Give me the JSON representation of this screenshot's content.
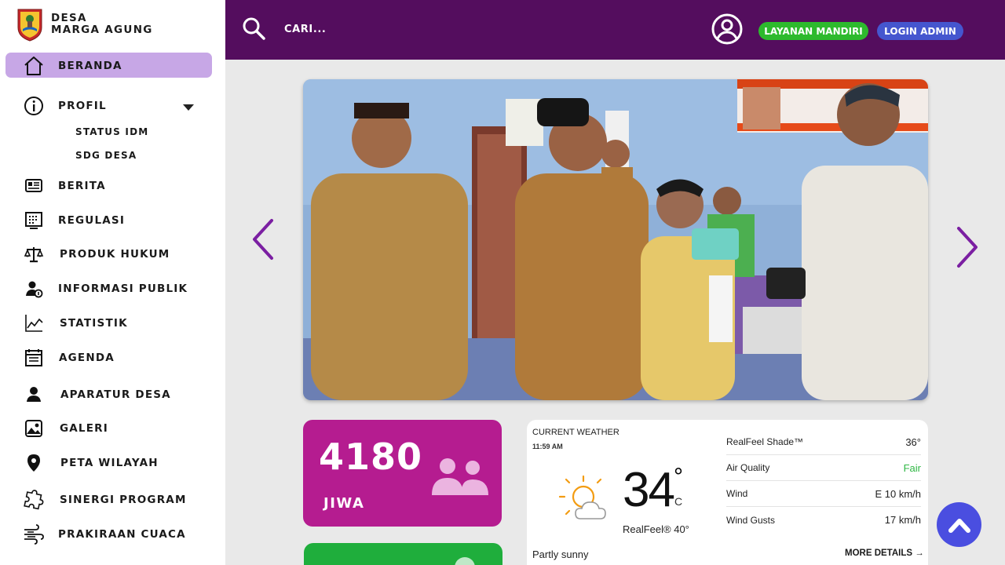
{
  "brand": {
    "line1": "DESA",
    "line2": "MARGA AGUNG"
  },
  "search": {
    "placeholder": "CARI..."
  },
  "header": {
    "layanan_label": "LAYANAN MANDIRI",
    "login_label": "LOGIN ADMIN"
  },
  "sidebar": {
    "active": "BERANDA",
    "items": [
      {
        "label": "BERANDA",
        "icon": "home-icon"
      },
      {
        "label": "PROFIL",
        "icon": "info-icon"
      },
      {
        "label": "BERITA",
        "icon": "newspaper-icon"
      },
      {
        "label": "REGULASI",
        "icon": "document-grid-icon"
      },
      {
        "label": "PRODUK HUKUM",
        "icon": "scales-icon"
      },
      {
        "label": "INFORMASI PUBLIK",
        "icon": "user-info-icon"
      },
      {
        "label": "STATISTIK",
        "icon": "chart-icon"
      },
      {
        "label": "AGENDA",
        "icon": "calendar-icon"
      },
      {
        "label": "APARATUR DESA",
        "icon": "person-icon"
      },
      {
        "label": "GALERI",
        "icon": "gallery-icon"
      },
      {
        "label": "PETA WILAYAH",
        "icon": "map-pin-icon"
      },
      {
        "label": "SINERGI PROGRAM",
        "icon": "puzzle-icon"
      },
      {
        "label": "PRAKIRAAN CUACA",
        "icon": "wind-icon"
      }
    ],
    "profil_sub": [
      "STATUS  IDM",
      "SDG DESA"
    ]
  },
  "stats": {
    "population": "4180",
    "unit": "JIWA"
  },
  "weather": {
    "title": "CURRENT WEATHER",
    "time": "11:59 AM",
    "temp": "34",
    "degree": "°",
    "unit": "C",
    "realfeel": "RealFeel® 40°",
    "condition": "Partly sunny",
    "more": "MORE DETAILS",
    "details": [
      {
        "label": "RealFeel Shade™",
        "value": "36°"
      },
      {
        "label": "Air Quality",
        "value": "Fair"
      },
      {
        "label": "Wind",
        "value": "E 10 km/h"
      },
      {
        "label": "Wind Gusts",
        "value": "17 km/h"
      }
    ]
  },
  "colors": {
    "topbar": "#540d5e",
    "active_nav": "#c7a7e6",
    "stat_card": "#b51c90",
    "green": "#2dba2d",
    "blue": "#4556cf",
    "accent_arrow": "#7b1fa2"
  }
}
